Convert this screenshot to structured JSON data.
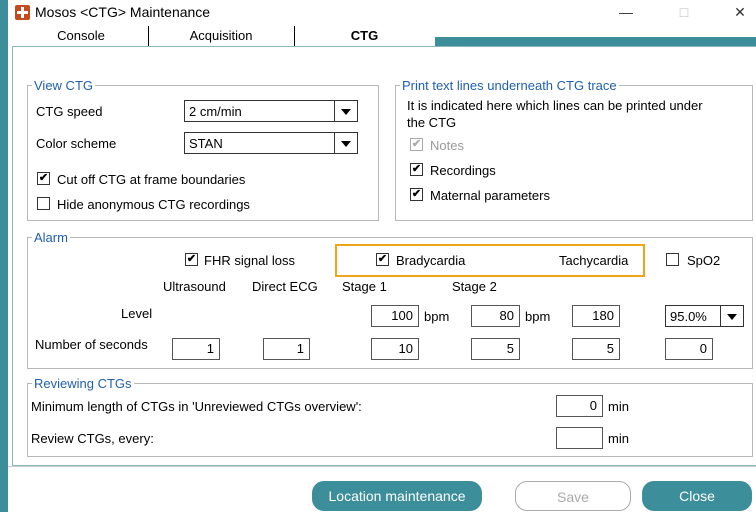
{
  "window": {
    "title": "Mosos <CTG> Maintenance",
    "controls": {
      "minimize": "—",
      "maximize": "□",
      "close": "✕"
    }
  },
  "tabs": [
    {
      "label": "Console",
      "active": false
    },
    {
      "label": "Acquisition",
      "active": false
    },
    {
      "label": "CTG",
      "active": true
    }
  ],
  "view_ctg": {
    "legend": "View CTG",
    "speed_label": "CTG speed",
    "speed_value": "2 cm/min",
    "scheme_label": "Color scheme",
    "scheme_value": "STAN",
    "cutoff_label": "Cut off CTG at frame boundaries",
    "cutoff_checked": true,
    "hide_label": "Hide anonymous CTG recordings",
    "hide_checked": false
  },
  "print_lines": {
    "legend": "Print text lines underneath CTG trace",
    "desc_line1": "It is indicated here which lines can be printed under",
    "desc_line2": "the CTG",
    "notes_label": "Notes",
    "recordings_label": "Recordings",
    "maternal_label": "Maternal parameters"
  },
  "alarm": {
    "legend": "Alarm",
    "fhr_label": "FHR signal loss",
    "brady_label": "Bradycardia",
    "tachy_label": "Tachycardia",
    "spo2_label": "SpO2",
    "col_ultrasound": "Ultrasound",
    "col_direct_ecg": "Direct ECG",
    "col_stage1": "Stage 1",
    "col_stage2": "Stage 2",
    "level_label": "Level",
    "seconds_label": "Number of seconds",
    "level_stage1": "100",
    "level_stage2": "80",
    "level_tachy": "180",
    "level_spo2": "95.0%",
    "bpm": "bpm",
    "sec_ultrasound": "1",
    "sec_direct_ecg": "1",
    "sec_stage1": "10",
    "sec_stage2": "5",
    "sec_tachy": "5",
    "sec_spo2": "0"
  },
  "reviewing": {
    "legend": "Reviewing CTGs",
    "min_length_label": "Minimum length of CTGs in 'Unreviewed CTGs overview':",
    "min_length_value": "0",
    "review_every_label": "Review CTGs, every:",
    "review_every_value": "",
    "unit": "min"
  },
  "footer": {
    "location_button": "Location maintenance",
    "save_button": "Save",
    "close_button": "Close"
  },
  "colors": {
    "accent": "#3c8e9a",
    "legend_text": "#2060b0",
    "highlight": "#f0a418"
  }
}
